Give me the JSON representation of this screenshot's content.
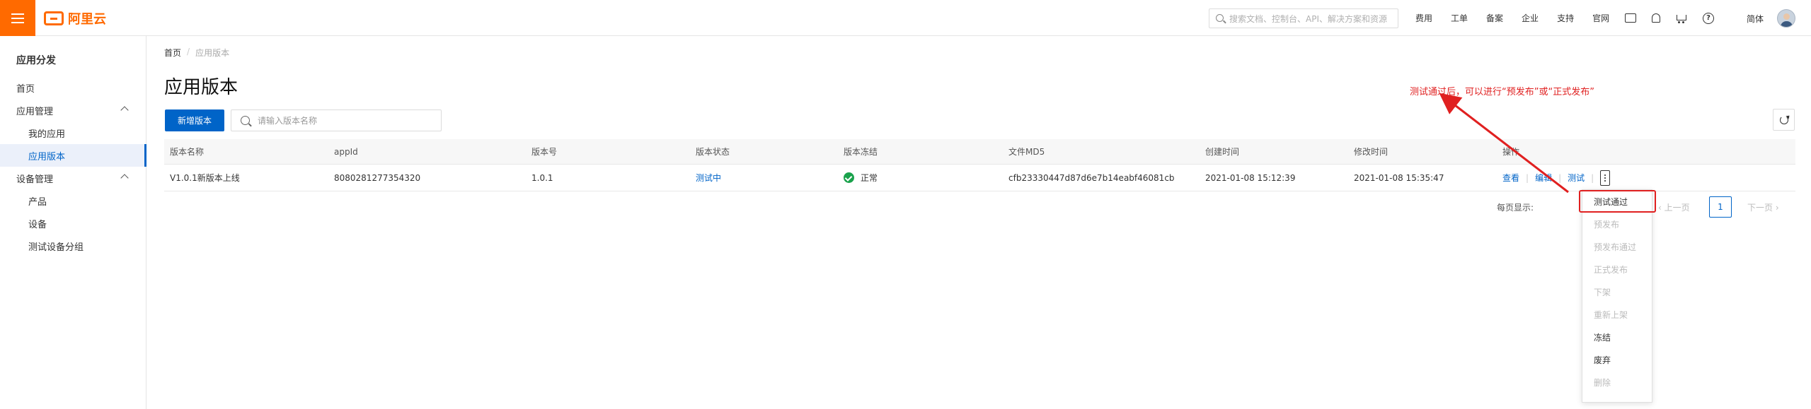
{
  "header": {
    "logo_text": "阿里云",
    "search_placeholder": "搜索文档、控制台、API、解决方案和资源",
    "links": [
      "费用",
      "工单",
      "备案",
      "企业",
      "支持",
      "官网"
    ],
    "lang": "简体",
    "icons": [
      "image-icon",
      "bell-icon",
      "cart-icon",
      "help-icon"
    ]
  },
  "sidebar": {
    "title": "应用分发",
    "home": "首页",
    "app_mgmt": "应用管理",
    "my_apps": "我的应用",
    "app_versions": "应用版本",
    "device_mgmt": "设备管理",
    "products": "产品",
    "devices": "设备",
    "test_groups": "测试设备分组"
  },
  "breadcrumb": {
    "home": "首页",
    "sep": "/",
    "current": "应用版本"
  },
  "main": {
    "title": "应用版本",
    "add_button": "新增版本",
    "search_placeholder": "请输入版本名称"
  },
  "table": {
    "headers": [
      "版本名称",
      "appId",
      "版本号",
      "版本状态",
      "版本冻结",
      "文件MD5",
      "创建时间",
      "修改时间",
      "操作"
    ],
    "rows": [
      {
        "name": "V1.0.1新版本上线",
        "app_id": "8080281277354320",
        "version": "1.0.1",
        "status": "测试中",
        "frozen": "正常",
        "md5": "cfb23330447d87d6e7b14eabf46081cb",
        "created": "2021-01-08 15:12:39",
        "modified": "2021-01-08 15:35:47",
        "ops": {
          "view": "查看",
          "edit": "编辑",
          "test": "测试",
          "sep": "|"
        }
      }
    ]
  },
  "pager": {
    "label": "每页显示:",
    "prev": "上一页",
    "page": "1",
    "next": "下一页"
  },
  "dropdown": {
    "items": [
      {
        "label": "测试通过",
        "enabled": true
      },
      {
        "label": "预发布",
        "enabled": false
      },
      {
        "label": "预发布通过",
        "enabled": false
      },
      {
        "label": "正式发布",
        "enabled": false
      },
      {
        "label": "下架",
        "enabled": false
      },
      {
        "label": "重新上架",
        "enabled": false
      },
      {
        "label": "冻结",
        "enabled": true
      },
      {
        "label": "废弃",
        "enabled": true
      },
      {
        "label": "删除",
        "enabled": false
      }
    ]
  },
  "annotation": {
    "text": "测试通过后，可以进行“预发布”或“正式发布”",
    "color": "#e02020"
  },
  "colors": {
    "brand": "#ff6a00",
    "primary": "#0064c8",
    "ok": "#1aa24c"
  }
}
